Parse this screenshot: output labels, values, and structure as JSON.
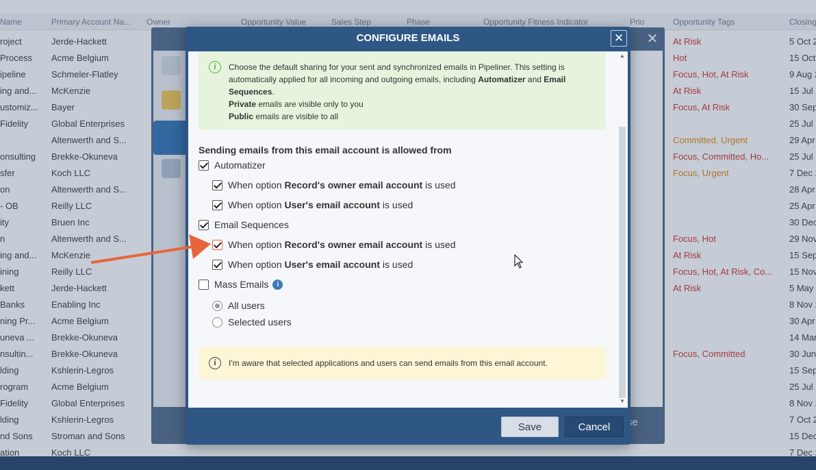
{
  "background": {
    "columns": [
      "Name",
      "Primary Account Na...",
      "Owner",
      "Opportunity Value",
      "Sales Step",
      "Phase",
      "Opportunity Fitness Indicator",
      "Prio",
      "Opportunity Tags",
      "Closing"
    ],
    "rows": [
      {
        "name": "roject",
        "account": "Jerde-Hackett",
        "tags": "At Risk",
        "tag_color": "red",
        "date": "5 Oct 2"
      },
      {
        "name": "Process",
        "account": "Acme Belgium",
        "tags": "Hot",
        "tag_color": "red",
        "date": "15 Oct 2"
      },
      {
        "name": "ipeline",
        "account": "Schmeler-Flatley",
        "tags": "Focus, Hot, At Risk",
        "tag_color": "red",
        "date": "9 Aug 2"
      },
      {
        "name": "ing and...",
        "account": "McKenzie",
        "tags": "At Risk",
        "tag_color": "red",
        "date": "15 Jul 2"
      },
      {
        "name": "ustomiz...",
        "account": "Bayer",
        "tags": "Focus, At Risk",
        "tag_color": "red",
        "date": "30 Sep 2"
      },
      {
        "name": "Fidelity",
        "account": "Global Enterprises",
        "tags": "",
        "tag_color": "",
        "date": "25 Jul 2"
      },
      {
        "name": "",
        "account": "Altenwerth and S...",
        "tags": "Committed, Urgent",
        "tag_color": "orange",
        "date": "29 Apr 2"
      },
      {
        "name": "onsulting",
        "account": "Brekke-Okuneva",
        "tags": "Focus, Committed, Ho...",
        "tag_color": "red",
        "date": "25 Jul 2"
      },
      {
        "name": "sfer",
        "account": "Koch LLC",
        "tags": "Focus, Urgent",
        "tag_color": "orange",
        "date": "7 Dec 2"
      },
      {
        "name": "on",
        "account": "Altenwerth and S...",
        "tags": "",
        "tag_color": "",
        "date": "28 Apr 2"
      },
      {
        "name": "- OB",
        "account": "Reilly LLC",
        "tags": "",
        "tag_color": "",
        "date": "25 Apr 2"
      },
      {
        "name": "ity",
        "account": "Bruen Inc",
        "tags": "",
        "tag_color": "",
        "date": "30 Dec 2"
      },
      {
        "name": "n",
        "account": "Altenwerth and S...",
        "tags": "Focus, Hot",
        "tag_color": "red",
        "date": "29 Nov 2"
      },
      {
        "name": "ing and...",
        "account": "McKenzie",
        "tags": "At Risk",
        "tag_color": "red",
        "date": "15 Sep 2"
      },
      {
        "name": "ining",
        "account": "Reilly LLC",
        "tags": "Focus, Hot, At Risk, Co...",
        "tag_color": "red",
        "date": "15 Nov 2"
      },
      {
        "name": "kett",
        "account": "Jerde-Hackett",
        "tags": "At Risk",
        "tag_color": "red",
        "date": "5 May 2"
      },
      {
        "name": "Banks",
        "account": "Enabling Inc",
        "tags": "",
        "tag_color": "",
        "date": "8 Nov 2"
      },
      {
        "name": "ning Pr...",
        "account": "Acme Belgium",
        "tags": "",
        "tag_color": "",
        "date": "30 Apr 2"
      },
      {
        "name": "uneva ...",
        "account": "Brekke-Okuneva",
        "tags": "",
        "tag_color": "",
        "date": "14 Mar 2"
      },
      {
        "name": "nsultin...",
        "account": "Brekke-Okuneva",
        "tags": "Focus, Committed",
        "tag_color": "red",
        "date": "30 Jun 2"
      },
      {
        "name": "lding",
        "account": "Kshlerin-Legros",
        "tags": "",
        "tag_color": "",
        "date": "15 Sep 2"
      },
      {
        "name": "rogram",
        "account": "Acme Belgium",
        "tags": "",
        "tag_color": "",
        "date": "25 Jul 2"
      },
      {
        "name": "Fidelity",
        "account": "Global Enterprises",
        "tags": "",
        "tag_color": "",
        "date": "8 Nov 2"
      },
      {
        "name": "lding",
        "account": "Kshlerin-Legros",
        "tags": "",
        "tag_color": "",
        "date": "7 Oct 2"
      },
      {
        "name": "nd Sons",
        "account": "Stroman and Sons",
        "tags": "",
        "tag_color": "",
        "date": "15 Dec 2"
      },
      {
        "name": "ation",
        "account": "Koch LLC",
        "tags": "",
        "tag_color": "",
        "date": "7 Dec 2"
      }
    ],
    "under_window_button": "se"
  },
  "modal": {
    "title": "CONFIGURE EMAILS",
    "close_label": "✕",
    "info_text_1": "Choose the default sharing for your sent and synchronized emails in Pipeliner. This setting is automatically applied for all incoming and outgoing emails, including ",
    "info_bold_1": "Automatizer",
    "info_text_2": " and ",
    "info_bold_2": "Email Sequences",
    "info_text_3": ".",
    "private_bold": "Private",
    "private_text": " emails are visible only to you",
    "public_bold": "Public",
    "public_text": " emails are visible to all",
    "section_title": "Sending emails from this email account is allowed from",
    "options": {
      "automatizer": {
        "label": "Automatizer",
        "checked": true
      },
      "auto_owner": {
        "prefix": "When option ",
        "bold": "Record's owner email account",
        "suffix": " is used",
        "checked": true
      },
      "auto_user": {
        "prefix": "When option ",
        "bold": "User's email account",
        "suffix": " is used",
        "checked": true
      },
      "sequences": {
        "label": "Email Sequences",
        "checked": true
      },
      "seq_owner": {
        "prefix": "When option ",
        "bold": "Record's owner email account",
        "suffix": " is used",
        "checked": true
      },
      "seq_user": {
        "prefix": "When option ",
        "bold": "User's email account",
        "suffix": " is used",
        "checked": true
      },
      "mass": {
        "label": "Mass Emails",
        "checked": false
      },
      "all_users": {
        "label": "All users",
        "selected": true
      },
      "selected_users": {
        "label": "Selected users",
        "selected": false
      }
    },
    "warning_text": "I'm aware that selected applications and users can send emails from this email account.",
    "save_label": "Save",
    "cancel_label": "Cancel"
  },
  "colors": {
    "modal_header": "#2f5786",
    "info_green_bg": "#e6f4de",
    "info_yellow_bg": "#fdf6d6",
    "arrow": "#e8643a"
  }
}
